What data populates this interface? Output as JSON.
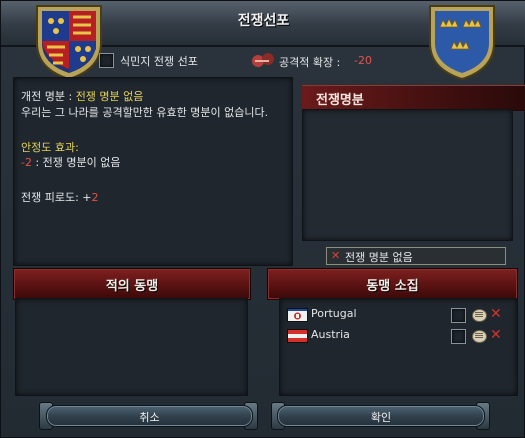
{
  "window": {
    "title": "전쟁선포"
  },
  "options": {
    "colonial_war_label": "식민지 전쟁 선포",
    "aggressive_expansion_label": "공격적 확장 :",
    "aggressive_expansion_value": "-20"
  },
  "info": {
    "casus_belli_label": "개전 명분 :",
    "casus_belli_value": "전쟁 명분 없음",
    "no_cb_desc": "우리는 그 나라를 공격할만한 유효한 명분이 없습니다.",
    "stability_label": "안정도 효과:",
    "stability_value": "-2",
    "stability_reason": ": 전쟁 명분이 없음",
    "war_exhaustion_label": "전쟁 피로도: +",
    "war_exhaustion_value": "2"
  },
  "casus_belli_panel": {
    "header": "전쟁명분",
    "selected": "전쟁 명분 없음"
  },
  "enemy_allies": {
    "header": "적의 동맹"
  },
  "call_allies": {
    "header": "동맹 소집",
    "allies": [
      {
        "name": "Portugal"
      },
      {
        "name": "Austria"
      }
    ]
  },
  "buttons": {
    "cancel": "취소",
    "confirm": "확인"
  }
}
